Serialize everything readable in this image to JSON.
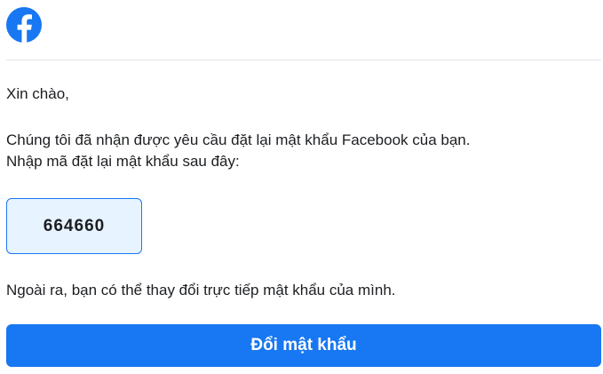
{
  "header": {
    "logo_icon": "facebook-logo-icon",
    "brand_color": "#1877f2"
  },
  "email": {
    "greeting": "Xin chào,",
    "line1": "Chúng tôi đã nhận được yêu cầu đặt lại mật khẩu Facebook của bạn.",
    "line2": "Nhập mã đặt lại mật khẩu sau đây:",
    "code": "664660",
    "alt_text": "Ngoài ra, bạn có thể thay đổi trực tiếp mật khẩu của mình.",
    "button_label": "Đổi mật khẩu"
  },
  "colors": {
    "code_box_bg": "#e7f3ff",
    "button_bg": "#1877f2",
    "button_text": "#ffffff"
  }
}
